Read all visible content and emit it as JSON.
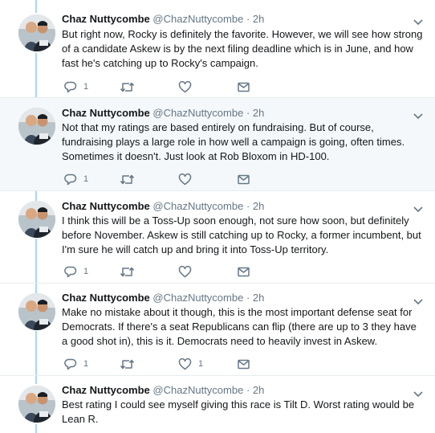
{
  "colors": {
    "thread_line": "#a7d8f8",
    "icon": "#657786",
    "highlight_bg": "#f5f8fa"
  },
  "tweets": [
    {
      "name": "Chaz Nuttycombe",
      "handle": "@ChazNuttycombe",
      "dot": "·",
      "time": "2h",
      "text": "But right now, Rocky is definitely the favorite. However, we will see how strong of a candidate Askew is by the next filing deadline which is in June, and how fast he's catching up to Rocky's campaign.",
      "reply_count": "1",
      "retweet_count": "",
      "like_count": ""
    },
    {
      "name": "Chaz Nuttycombe",
      "handle": "@ChazNuttycombe",
      "dot": "·",
      "time": "2h",
      "text": "Not that my ratings are based entirely on fundraising. But of course, fundraising plays a large role in how well a campaign is going, often times. Sometimes it doesn't. Just look at Rob Bloxom in HD-100.",
      "reply_count": "1",
      "retweet_count": "",
      "like_count": ""
    },
    {
      "name": "Chaz Nuttycombe",
      "handle": "@ChazNuttycombe",
      "dot": "·",
      "time": "2h",
      "text": "I think this will be a Toss-Up soon enough, not sure how soon, but definitely before November. Askew is still catching up to Rocky, a former incumbent, but I'm sure he will catch up and bring it into Toss-Up territory.",
      "reply_count": "1",
      "retweet_count": "",
      "like_count": ""
    },
    {
      "name": "Chaz Nuttycombe",
      "handle": "@ChazNuttycombe",
      "dot": "·",
      "time": "2h",
      "text": "Make no mistake about it though, this is the most important defense seat for Democrats. If there's a seat Republicans can flip (there are up to 3 they have a good shot in), this is it. Democrats need to heavily invest in Askew.",
      "reply_count": "1",
      "retweet_count": "",
      "like_count": "1"
    },
    {
      "name": "Chaz Nuttycombe",
      "handle": "@ChazNuttycombe",
      "dot": "·",
      "time": "2h",
      "text": "Best rating I could see myself giving this race is Tilt D. Worst rating would be Lean R.",
      "reply_count": "",
      "retweet_count": "",
      "like_count": ""
    }
  ]
}
